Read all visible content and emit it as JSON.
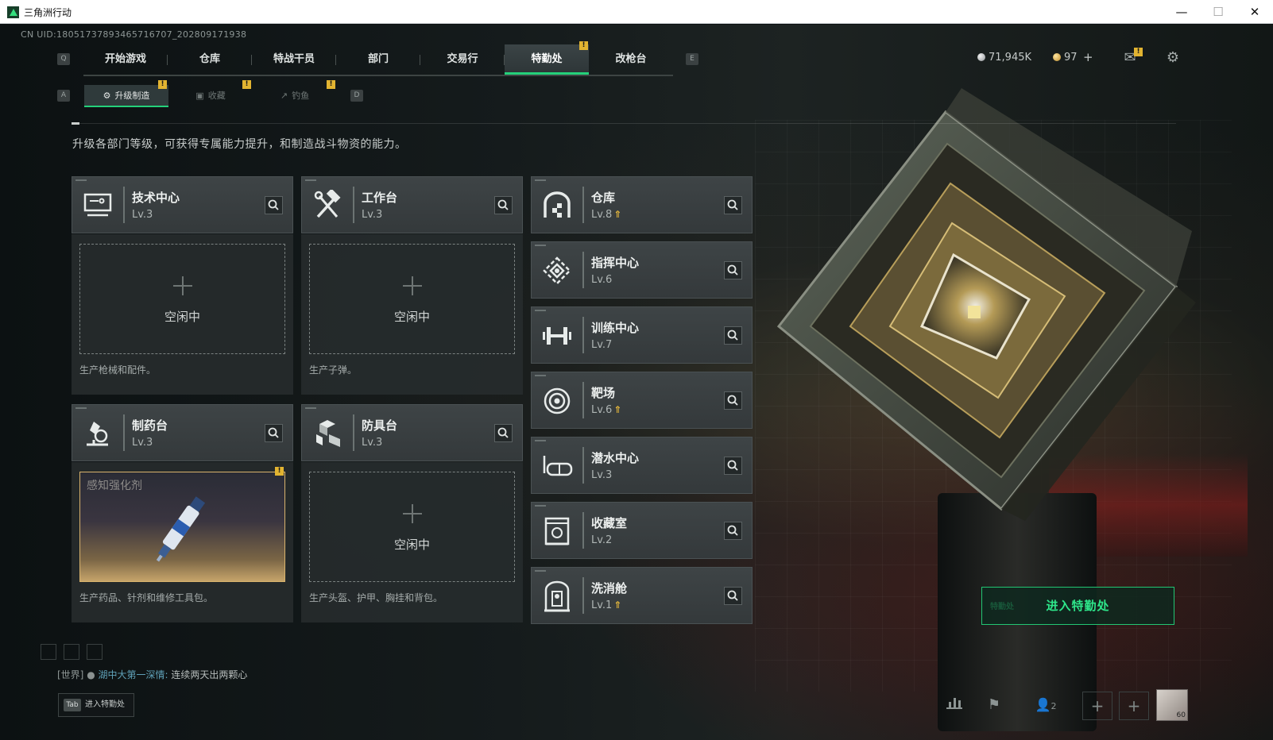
{
  "window": {
    "title": "三角洲行动",
    "min": "—",
    "max": "☐",
    "close": "✕"
  },
  "uid": "CN UID:18051737893465716707_202809171938",
  "main_tabs": {
    "prev_key": "Q",
    "next_key": "E",
    "items": [
      {
        "label": "开始游戏"
      },
      {
        "label": "仓库"
      },
      {
        "label": "特战干员"
      },
      {
        "label": "部门"
      },
      {
        "label": "交易行"
      },
      {
        "label": "特勤处"
      },
      {
        "label": "改枪台"
      }
    ],
    "active_index": 5
  },
  "sub_tabs": {
    "prev_key": "A",
    "next_key": "D",
    "items": [
      {
        "label": "升级制造"
      },
      {
        "label": "收藏"
      },
      {
        "label": "钓鱼"
      }
    ]
  },
  "currency": {
    "silver": "71,945K",
    "gold": "97",
    "add": "+"
  },
  "alert_mark": "!",
  "description": "升级各部门等级，可获得专属能力提升，和制造战斗物资的能力。",
  "production": [
    {
      "name": "技术中心",
      "level": "Lv.3",
      "icon": "computer-icon",
      "status": "空闲中",
      "hint": "生产枪械和配件。"
    },
    {
      "name": "工作台",
      "level": "Lv.3",
      "icon": "hammer-wrench-icon",
      "status": "空闲中",
      "hint": "生产子弹。"
    },
    {
      "name": "制药台",
      "level": "Lv.3",
      "icon": "microscope-icon",
      "product": "感知强化剂",
      "hint": "生产药品、针剂和维修工具包。"
    },
    {
      "name": "防具台",
      "level": "Lv.3",
      "icon": "armor-blocks-icon",
      "status": "空闲中",
      "hint": "生产头盔、护甲、胸挂和背包。"
    }
  ],
  "departments": [
    {
      "name": "仓库",
      "level": "Lv.8",
      "upgrade": true,
      "icon": "warehouse-icon"
    },
    {
      "name": "指挥中心",
      "level": "Lv.6",
      "upgrade": false,
      "icon": "command-center-icon"
    },
    {
      "name": "训练中心",
      "level": "Lv.7",
      "upgrade": false,
      "icon": "dumbbell-icon"
    },
    {
      "name": "靶场",
      "level": "Lv.6",
      "upgrade": true,
      "icon": "target-icon"
    },
    {
      "name": "潜水中心",
      "level": "Lv.3",
      "upgrade": false,
      "icon": "diving-mask-icon"
    },
    {
      "name": "收藏室",
      "level": "Lv.2",
      "upgrade": false,
      "icon": "collection-icon"
    },
    {
      "name": "洗消舱",
      "level": "Lv.1",
      "upgrade": true,
      "icon": "decon-pod-icon"
    }
  ],
  "upgrade_mark": "⇑",
  "enter_button": {
    "label": "进入特勤处",
    "faint": "特勤处"
  },
  "chat": {
    "channel": "[世界]",
    "user": "湖中大第一深情:",
    "message": "连续两天出两颗心"
  },
  "tab_hint": {
    "key": "Tab",
    "label": "进入特勤处"
  },
  "bottom": {
    "team_count": "2",
    "add": "+",
    "avatar_level": "60"
  },
  "colors": {
    "accent": "#24d07a",
    "alert": "#e2b431",
    "upgrade": "#e0b43c"
  }
}
